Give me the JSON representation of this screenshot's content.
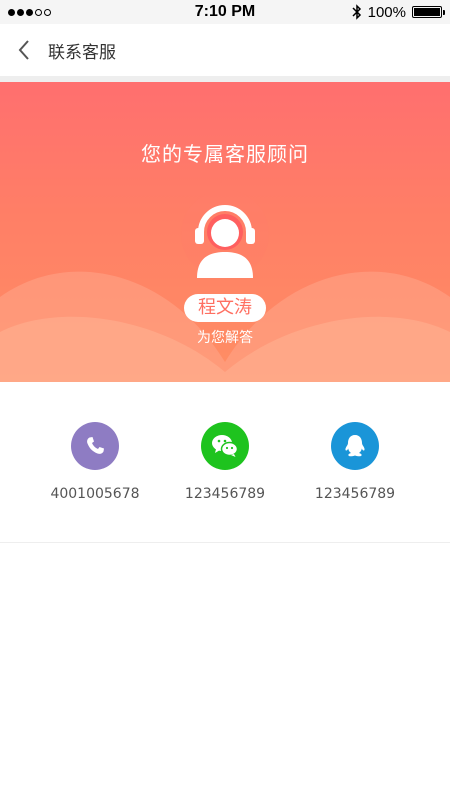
{
  "status_bar": {
    "time": "7:10 PM",
    "battery": "100%"
  },
  "header": {
    "title": "联系客服"
  },
  "hero": {
    "title": "您的专属客服顾问",
    "name": "程文涛",
    "subtitle": "为您解答"
  },
  "contacts": [
    {
      "icon": "phone-icon",
      "value": "4001005678",
      "color": "#8e7cc3"
    },
    {
      "icon": "wechat-icon",
      "value": "123456789",
      "color": "#1ec31e"
    },
    {
      "icon": "qq-icon",
      "value": "123456789",
      "color": "#1a95d8"
    }
  ]
}
